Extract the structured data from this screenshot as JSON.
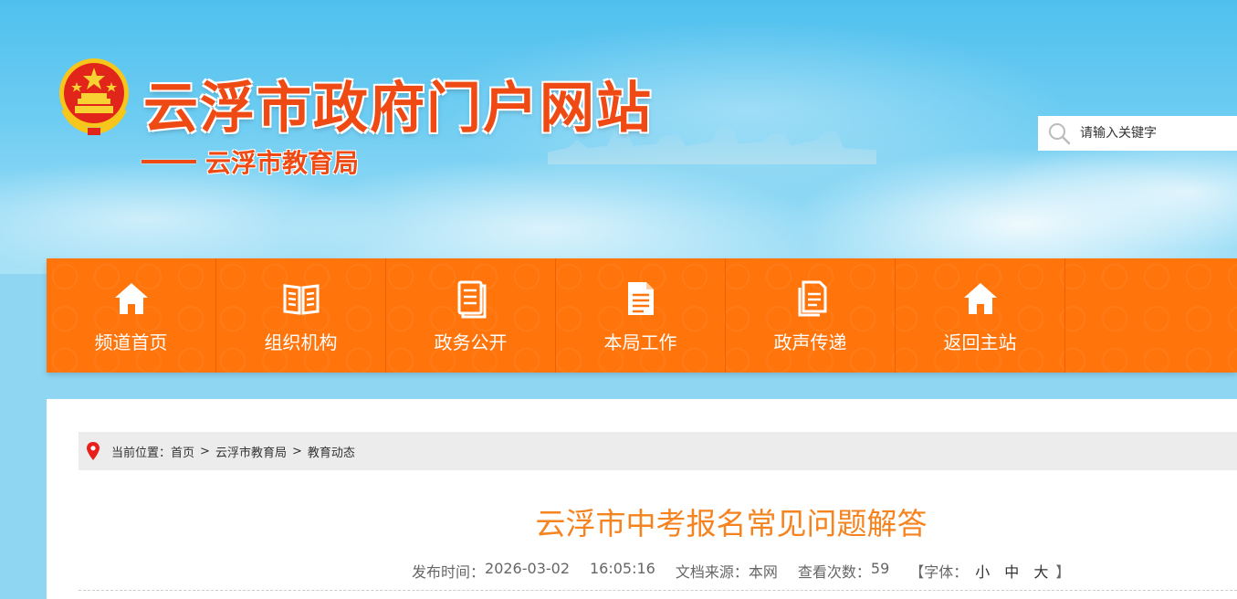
{
  "header": {
    "site_title": "云浮市政府门户网站",
    "sub_title": "云浮市教育局",
    "emblem_icon": "national-emblem-icon"
  },
  "search": {
    "placeholder": "请输入关键字",
    "icon": "search-icon"
  },
  "nav": {
    "items": [
      {
        "label": "频道首页",
        "icon": "home-icon"
      },
      {
        "label": "组织机构",
        "icon": "book-icon"
      },
      {
        "label": "政务公开",
        "icon": "document-icon"
      },
      {
        "label": "本局工作",
        "icon": "clipboard-icon"
      },
      {
        "label": "政声传递",
        "icon": "copy-document-icon"
      },
      {
        "label": "返回主站",
        "icon": "home-icon"
      }
    ]
  },
  "breadcrumb": {
    "prefix": "当前位置：",
    "items": [
      "首页",
      "云浮市教育局",
      "教育动态"
    ],
    "separator": ">"
  },
  "article": {
    "title": "云浮市中考报名常见问题解答",
    "meta": {
      "publish_label": "发布时间：",
      "publish_date": "2026-03-02",
      "publish_time": "16:05:16",
      "source_label": "文档来源：",
      "source": "本网",
      "views_label": "查看次数：",
      "views": "59",
      "font_label": "【字体：",
      "font_small": "小",
      "font_medium": "中",
      "font_large": "大",
      "font_close": "】"
    }
  },
  "colors": {
    "brand_orange": "#ff740b",
    "title_red": "#ef4a14",
    "article_title": "#f5831f"
  }
}
